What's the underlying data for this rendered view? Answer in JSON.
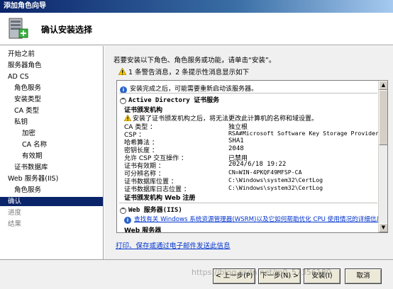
{
  "window": {
    "title": "添加角色向导"
  },
  "header": {
    "title": "确认安装选择"
  },
  "nav": {
    "items": [
      {
        "label": "开始之前",
        "state": "normal"
      },
      {
        "label": "服务器角色",
        "state": "normal"
      },
      {
        "label": "AD CS",
        "state": "normal"
      },
      {
        "label": "角色服务",
        "state": "normal"
      },
      {
        "label": "安装类型",
        "state": "normal"
      },
      {
        "label": "CA 类型",
        "state": "normal"
      },
      {
        "label": "私钥",
        "state": "normal"
      },
      {
        "label": "加密",
        "state": "normal"
      },
      {
        "label": "CA 名称",
        "state": "normal"
      },
      {
        "label": "有效期",
        "state": "normal"
      },
      {
        "label": "证书数据库",
        "state": "normal"
      },
      {
        "label": "Web 服务器(IIS)",
        "state": "normal"
      },
      {
        "label": "角色服务",
        "state": "normal"
      },
      {
        "label": "确认",
        "state": "active"
      },
      {
        "label": "进度",
        "state": "disabled"
      },
      {
        "label": "结果",
        "state": "disabled"
      }
    ]
  },
  "main": {
    "intro": "若要安装以下角色、角色服务或功能，请单击“安装”。",
    "warnings": "1 条警告消息，2 条提示性消息显示如下",
    "summary": {
      "restart_info": "安装完成之后，可能需要重新启动该服务器。",
      "adcs_section": "Active Directory 证书服务",
      "ca_heading": "证书颁发机构",
      "ca_warning": "安装了证书颁发机构之后，将无法更改此计算机的名称和域设置。",
      "details": [
        {
          "key": "CA 类型 ：",
          "value": "独立根"
        },
        {
          "key": "CSP ：",
          "value": "RSA#Microsoft Software Key Storage Provider"
        },
        {
          "key": "哈希算法 ：",
          "value": "SHA1"
        },
        {
          "key": "密钥长度 ：",
          "value": "2048"
        },
        {
          "key": "允许 CSP 交互操作 ：",
          "value": "已禁用"
        },
        {
          "key": "证书有效期 ：",
          "value": "2024/6/18 19:22"
        },
        {
          "key": "可分辨名称 ：",
          "value": "CN=WIN-4PKQF49MFSP-CA"
        },
        {
          "key": "证书数据库位置 ：",
          "value": "C:\\Windows\\system32\\CertLog"
        },
        {
          "key": "证书数据库日志位置 ：",
          "value": "C:\\Windows\\system32\\CertLog"
        }
      ],
      "web_enroll_heading": "证书颁发机构 Web 注册",
      "iis_section": "Web 服务器(IIS)",
      "iis_info": "查找有关 Windows 系统资源管理器(WSRM)以及它如何帮助优化 CPU 使用情况的详细信息",
      "web_server_heading": "Web 服务器"
    },
    "print_link": "打印、保存或通过电子邮件发送此信息"
  },
  "footer": {
    "prev": "< 上一步(P)",
    "next": "下一步(N) >",
    "install": "安装(I)",
    "cancel": "取消"
  },
  "watermark": "https://blog.csdn.net/m0_57356180"
}
